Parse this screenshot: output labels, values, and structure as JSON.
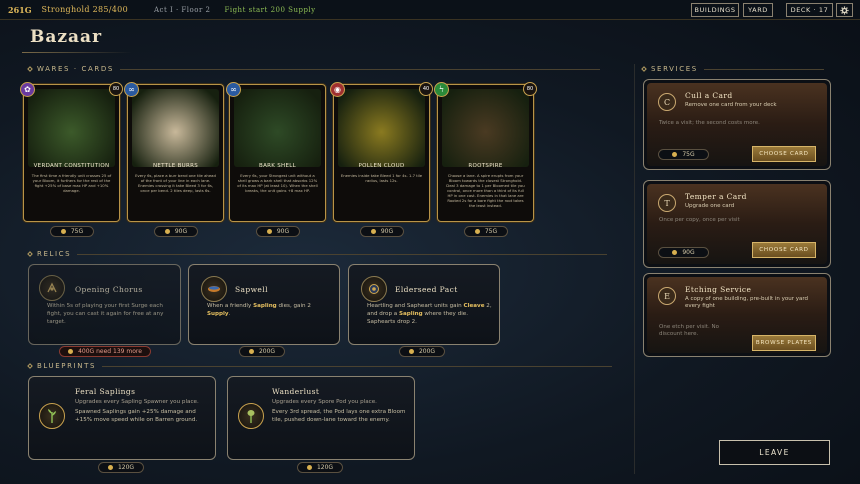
{
  "topbar": {
    "gold": "261G",
    "stronghold": "Stronghold 285/400",
    "act": "Act I · Floor 2",
    "fight": "Fight start 200 Supply",
    "buildings_label": "BUILDINGS",
    "yard_label": "YARD",
    "deck_label": "DECK · 17",
    "settings_icon": "gear-icon"
  },
  "page_title": "Bazaar",
  "sections": {
    "wares": "WARES · CARDS",
    "relics": "RELICS",
    "blueprints": "BLUEPRINTS",
    "services": "SERVICES"
  },
  "cards": [
    {
      "name": "VERDANT CONSTITUTION",
      "desc": "The first time a friendly unit crosses 25 of your Bloom, it furthers for the rest of the fight +25% of base max HP and +10% damage.",
      "cost": "80",
      "price": "75G",
      "icon": "growth-icon",
      "icon_color": "#6a3aa0",
      "art": "#3c5a2a"
    },
    {
      "name": "NETTLE BURRS",
      "desc": "Every 6s, place a burr bend one tile ahead of the front of your line in each lane. Enemies crossing it take Bleed 3 for 6s, once per bend. 2 tiles deep, lasts 6s.",
      "cost": "",
      "price": "90G",
      "icon": "link-icon",
      "icon_color": "#2a5aa0",
      "art": "#c8b89a"
    },
    {
      "name": "BARK SHELL",
      "desc": "Every 6s, your Strongest unit without a shell grows a bark shell that absorbs 12% of its max HP (at least 10). When the shell breaks, the unit gains +8 max HP.",
      "cost": "",
      "price": "90G",
      "icon": "link-icon",
      "icon_color": "#2a5aa0",
      "art": "#2e4a26"
    },
    {
      "name": "POLLEN CLOUD",
      "desc": "Enemies inside take Bleed 1 for 4s. 1.7 tile radius, lasts 12s.",
      "cost": "40",
      "price": "90G",
      "icon": "target-icon",
      "icon_color": "#a03030",
      "art": "#8a7a20"
    },
    {
      "name": "ROOTSPIRE",
      "desc": "Choose a lane. A spire erupts from your Bloom towards the closest Stronghold. Deal 3 damage to 1 per Bloomed tile you control, once more than a third of its full HP in one cast. Enemies in that lane are Rooted 2s for a bare fight the root takes the least instead.",
      "cost": "80",
      "price": "75G",
      "icon": "bolt-icon",
      "icon_color": "#2a8a3a",
      "art": "#4a3a22"
    }
  ],
  "relics": [
    {
      "name": "Opening Chorus",
      "desc": "Within 5s of playing your first Surge each fight, you can cast it again for free at any target.",
      "price": "400G need 139 more",
      "icon": "chorus-icon",
      "dim": true
    },
    {
      "name": "Sapwell",
      "desc_parts": [
        "When a friendly ",
        "Sapling",
        " dies, gain 2 ",
        "Supply",
        "."
      ],
      "price": "200G",
      "icon": "bowl-icon"
    },
    {
      "name": "Elderseed Pact",
      "desc_parts": [
        "Heartling and Sapheart units gain ",
        "Cleave",
        " 2, and drop a ",
        "Sapling",
        " where they die. Saphearts drop 2."
      ],
      "price": "200G",
      "icon": "seed-icon"
    }
  ],
  "blueprints": [
    {
      "name": "Feral Saplings",
      "sub": "Upgrades every Sapling Spawner you place.",
      "desc": "Spawned Saplings gain +25% damage and +15% move speed while on Barren ground.",
      "price": "120G",
      "icon": "sapling-icon"
    },
    {
      "name": "Wanderlust",
      "sub": "Upgrades every Spore Pod you place.",
      "desc": "Every 3rd spread, the Pod lays one extra Bloom tile, pushed down-lane toward the enemy.",
      "price": "120G",
      "icon": "pod-icon"
    }
  ],
  "services": [
    {
      "letter": "C",
      "title": "Cull a Card",
      "desc": "Remove one card from your deck",
      "note": "Twice a visit; the second costs more.",
      "price": "75G",
      "action": "CHOOSE CARD"
    },
    {
      "letter": "T",
      "title": "Temper a Card",
      "desc": "Upgrade one card",
      "note": "Once per copy, once per visit",
      "price": "90G",
      "action": "CHOOSE CARD"
    },
    {
      "letter": "E",
      "title": "Etching Service",
      "desc": "A copy of one building, pre-built in your yard every fight",
      "note": "One etch per visit. No discount here.",
      "price": "",
      "action": "BROWSE PLATES"
    }
  ],
  "leave_label": "LEAVE"
}
